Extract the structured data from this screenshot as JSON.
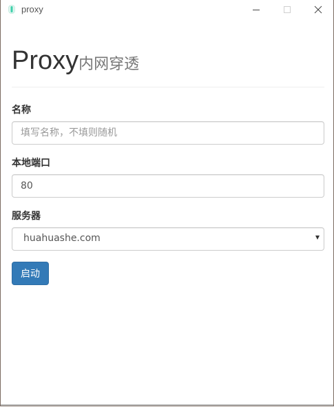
{
  "window": {
    "title": "proxy"
  },
  "header": {
    "title": "Proxy",
    "subtitle": "内网穿透"
  },
  "form": {
    "name": {
      "label": "名称",
      "value": "",
      "placeholder": "填写名称，不填则随机"
    },
    "local_port": {
      "label": "本地端口",
      "value": "80",
      "placeholder": ""
    },
    "server": {
      "label": "服务器",
      "selected": "huahuashe.com"
    },
    "start_button": "启动"
  },
  "colors": {
    "primary": "#337ab7",
    "app_icon": "#3ecfaa"
  },
  "icons": {
    "app": "app-icon",
    "minimize": "minimize-icon",
    "maximize": "maximize-icon",
    "close": "close-icon",
    "dropdown": "caret-down-icon"
  }
}
